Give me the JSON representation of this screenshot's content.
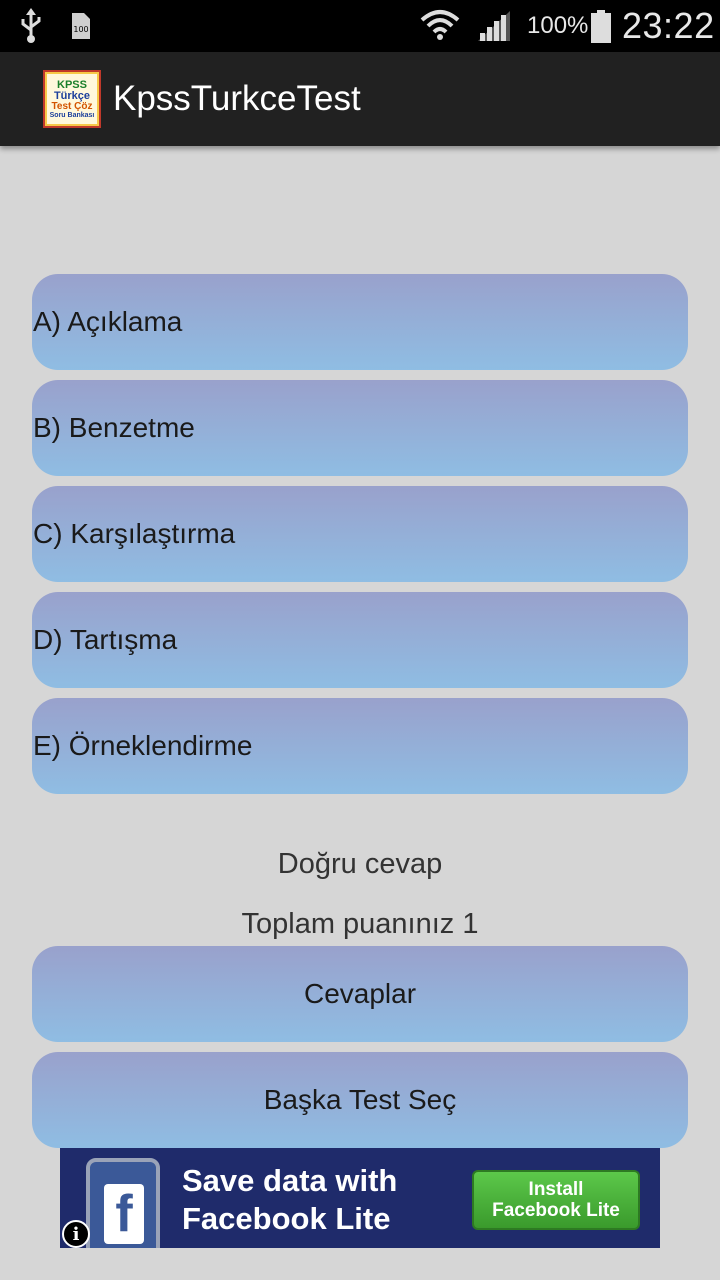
{
  "status_bar": {
    "battery_percent": "100%",
    "time": "23:22",
    "icons": [
      "usb-icon",
      "sim-icon",
      "wifi-icon",
      "signal-icon",
      "battery-icon"
    ],
    "sim_label": "100"
  },
  "app_bar": {
    "title": "KpssTurkceTest",
    "icon": {
      "line1": "KPSS",
      "line2": "Türkçe",
      "line3": "Test Çöz",
      "line4": "Soru Bankası"
    }
  },
  "options": [
    {
      "label": "A) Açıklama"
    },
    {
      "label": "B) Benzetme"
    },
    {
      "label": "C) Karşılaştırma"
    },
    {
      "label": "D) Tartışma"
    },
    {
      "label": "E) Örneklendirme"
    }
  ],
  "result": {
    "correct_text": "Doğru cevap",
    "score_text": "Toplam puanınız 1"
  },
  "actions": {
    "answers_label": "Cevaplar",
    "other_test_label": "Başka Test Seç"
  },
  "ad": {
    "headline_line1": "Save data with",
    "headline_line2": "Facebook Lite",
    "cta_line1": "Install",
    "cta_line2": "Facebook Lite",
    "info_symbol": "i"
  },
  "colors": {
    "background": "#d6d6d6",
    "app_bar": "#212121",
    "button_top": "#99a1cc",
    "button_bottom": "#8fbde3",
    "ad_background": "#1f2b6b"
  }
}
